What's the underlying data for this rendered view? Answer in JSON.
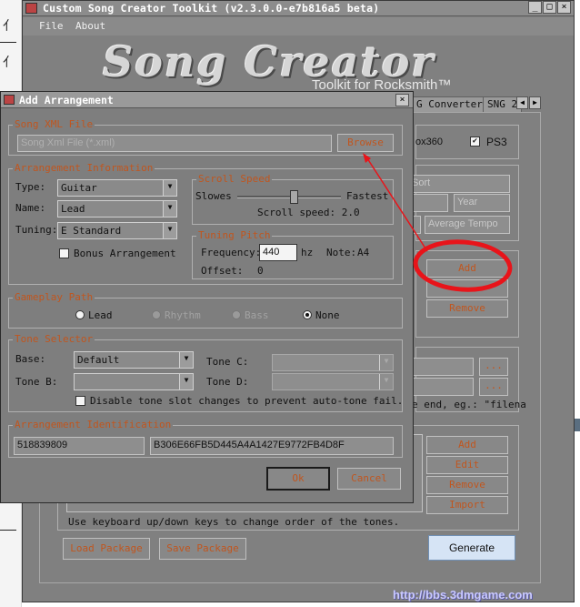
{
  "main_window": {
    "title": "Custom Song Creator Toolkit (v2.3.0.0-e7b816a5 beta)",
    "menu": [
      "File",
      "About"
    ],
    "logo": "Song Creator",
    "logo_sub": "Toolkit for Rocksmith™",
    "tabs": [
      "G Converter",
      "SNG 2"
    ],
    "platform_partial": "ox360",
    "platform_ps3": "PS3",
    "song_fields": {
      "sort_placeholder": "Sort",
      "year_placeholder": "Year",
      "tempo_placeholder": "Average Tempo"
    },
    "arrangement_buttons": {
      "add": "Add",
      "remove": "Remove"
    },
    "ellipsis": "...",
    "hint_partial": "e end, eg.: \"filena",
    "tone_buttons": {
      "add": "Add",
      "edit": "Edit",
      "remove": "Remove",
      "import": "Import"
    },
    "tone_hint": "Use keyboard up/down keys to change order of the tones.",
    "load_package": "Load Package",
    "save_package": "Save Package",
    "generate": "Generate"
  },
  "dialog": {
    "title": "Add Arrangement",
    "song_xml": {
      "legend": "Song XML File",
      "placeholder": "Song Xml File (*.xml)",
      "browse": "Browse"
    },
    "arrangement_info": {
      "legend": "Arrangement Information",
      "type_label": "Type:",
      "type_value": "Guitar",
      "name_label": "Name:",
      "name_value": "Lead",
      "tuning_label": "Tuning:",
      "tuning_value": "E Standard",
      "bonus_label": "Bonus Arrangement",
      "bonus_checked": false
    },
    "scroll_speed": {
      "legend": "Scroll Speed",
      "slowest": "Slowes",
      "fastest": "Fastest",
      "text": "Scroll speed: 2.0",
      "level": 0.55
    },
    "tuning_pitch": {
      "legend": "Tuning Pitch",
      "frequency_label": "Frequency:",
      "frequency_value": "440",
      "hz": "hz",
      "note_label": "Note:",
      "note_value": "A4",
      "offset_label": "Offset:",
      "offset_value": "0"
    },
    "gameplay_path": {
      "legend": "Gameplay Path",
      "options": [
        "Lead",
        "Rhythm",
        "Bass",
        "None"
      ],
      "selected": "None"
    },
    "tone_selector": {
      "legend": "Tone Selector",
      "base_label": "Base:",
      "base_value": "Default",
      "tone_b_label": "Tone B:",
      "tone_c_label": "Tone C:",
      "tone_d_label": "Tone D:",
      "disable_label": "Disable tone slot changes to prevent auto-tone fail."
    },
    "identification": {
      "legend": "Arrangement Identification",
      "id": "518839809",
      "guid": "B306E66FB5D445A4A1427E9772FB4D8F"
    },
    "ok": "Ok",
    "cancel": "Cancel"
  },
  "watermark": "http://bbs.3dmgame.com",
  "colors": {
    "window_bg": "#808080",
    "accent_text": "#c0561f",
    "annotation": "#e8141a"
  }
}
